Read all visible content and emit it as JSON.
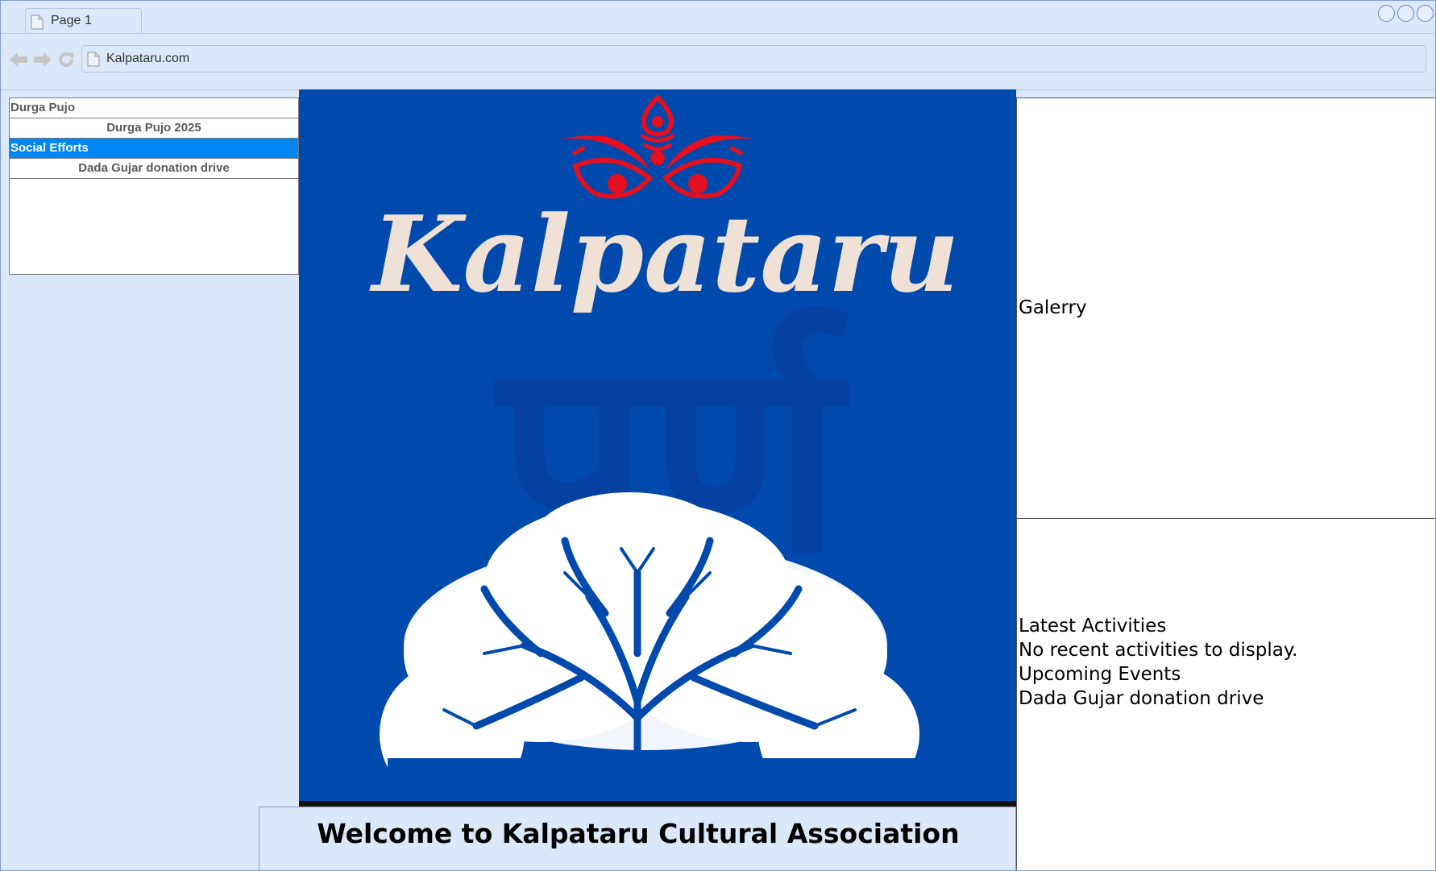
{
  "browser": {
    "tab_title": "Page 1",
    "url": "Kalpataru.com"
  },
  "nav": {
    "items": [
      {
        "label": "Durga Pujo",
        "level": "category"
      },
      {
        "label": "Durga Pujo 2025",
        "level": "item"
      },
      {
        "label": "Social Efforts",
        "level": "category",
        "selected": true
      },
      {
        "label": "Dada Gujar donation drive",
        "level": "item"
      }
    ]
  },
  "hero": {
    "logo_text": "Kalpataru",
    "watermark": "पर्ण",
    "background_color": "#0049ad",
    "logo_color": "#efe1d6",
    "accent_color": "#e3101f"
  },
  "welcome": {
    "text": "Welcome to Kalpataru Cultural Association"
  },
  "gallery": {
    "title": "Galerry"
  },
  "activities": {
    "latest_title": "Latest Activities",
    "latest_empty": "No recent activities to display.",
    "upcoming_title": "Upcoming Events",
    "upcoming_items": [
      "Dada Gujar donation drive"
    ]
  },
  "colors": {
    "chrome_bg": "#dbe8f9",
    "nav_selected": "#0087f3"
  },
  "icons": {
    "back": "arrow-left-icon",
    "forward": "arrow-right-icon",
    "reload": "reload-icon",
    "page": "page-icon"
  }
}
